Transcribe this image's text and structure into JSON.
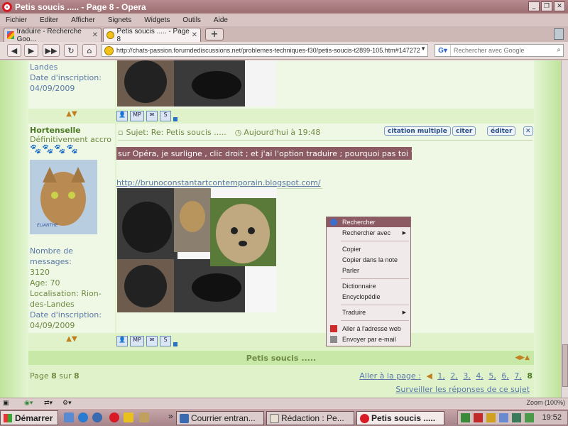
{
  "window": {
    "title": "Petis soucis ..... - Page 8 - Opera"
  },
  "menu": [
    "Fichier",
    "Editer",
    "Afficher",
    "Signets",
    "Widgets",
    "Outils",
    "Aide"
  ],
  "tabs": [
    {
      "label": "traduire - Recherche Goo..."
    },
    {
      "label": "Petis soucis ..... - Page 8"
    }
  ],
  "nav": {
    "url": "http://chats-passion.forumdediscussions.net/problemes-techniques-f30/petis-soucis-t2899-105.htm#147272",
    "search_placeholder": "Rechercher avec Google"
  },
  "post_prev": {
    "location_tail": "Landes",
    "date_label": "Date d'inscription:",
    "date": "04/09/2009"
  },
  "post": {
    "author": "Hortenselle",
    "rank": "Définitivement accro",
    "paws": "🐾🐾🐾🐾",
    "avatar_label": "ELIANTHE",
    "messages_label": "Nombre de messages:",
    "messages": "3120",
    "age_label": "Age:",
    "age": "70",
    "loc_label": "Localisation:",
    "loc": "Rion-des-Landes",
    "date_label": "Date d'inscription:",
    "date": "04/09/2009",
    "subject": "Sujet: Re: Petis soucis .....",
    "time": "Aujourd'hui à 19:48",
    "btn_multi": "citation multiple",
    "btn_quote": "citer",
    "btn_edit": "éditer",
    "text": "sur Opéra, je surligne , clic droit ; et j'ai l'option traduire ; pourquoi pas toi ?",
    "link": "http://brunoconstantartcontemporain.blogspot.com/"
  },
  "context_menu": {
    "items": [
      "Rechercher",
      "Rechercher avec",
      "Copier",
      "Copier dans la note",
      "Parler",
      "Dictionnaire",
      "Encyclopédie",
      "Traduire",
      "Aller à l'adresse web",
      "Envoyer par e-mail"
    ]
  },
  "topic_bar": {
    "title": "Petis soucis ....."
  },
  "pagination": {
    "page_label": "Page",
    "current": "8",
    "sur": "sur",
    "total": "8",
    "goto_label": "Aller à la page :",
    "pages": [
      "1,",
      "2,",
      "3,",
      "4,",
      "5,",
      "6,",
      "7,"
    ],
    "last": "8",
    "watch": "Surveiller les réponses de ce sujet"
  },
  "statusbar": {
    "zoom": "Zoom (100%)"
  },
  "taskbar": {
    "start": "Démarrer",
    "tasks": [
      "Courrier entran...",
      "Rédaction : Pe...",
      "Petis soucis ....."
    ],
    "clock": "19:52"
  },
  "colors": {
    "accent": "#8c5a62",
    "forum_bg": "#dff2ca",
    "green_text": "#6f8a42",
    "blue_text": "#5a78a8"
  }
}
